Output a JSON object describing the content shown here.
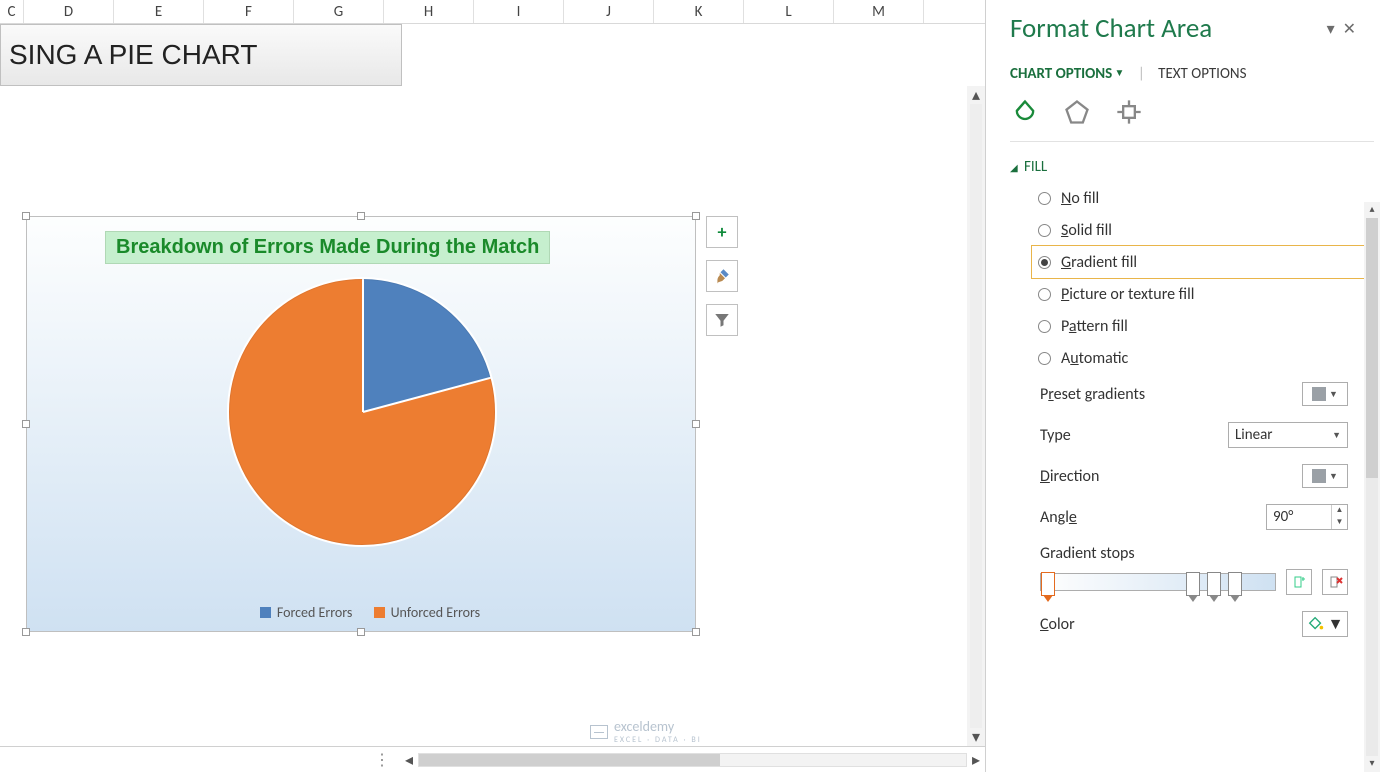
{
  "columns": [
    "C",
    "D",
    "E",
    "F",
    "G",
    "H",
    "I",
    "J",
    "K",
    "L",
    "M"
  ],
  "merged_cell_text": "SING A PIE CHART",
  "chart": {
    "title": "Breakdown of Errors Made During the Match",
    "legend": [
      "Forced Errors",
      "Unforced Errors"
    ]
  },
  "chart_data": {
    "type": "pie",
    "title": "Breakdown of Errors Made During the Match",
    "series": [
      {
        "name": "Forced Errors",
        "value": 21,
        "color": "#4f81bd"
      },
      {
        "name": "Unforced Errors",
        "value": 79,
        "color": "#ed7d31"
      }
    ]
  },
  "chart_buttons": {
    "plus": "+",
    "brush": "brush-icon",
    "filter": "filter-icon"
  },
  "watermark": {
    "text": "exceldemy",
    "sub": "EXCEL · DATA · BI"
  },
  "pane": {
    "title": "Format Chart Area",
    "tabs": {
      "chart_options": "CHART OPTIONS",
      "text_options": "TEXT OPTIONS"
    },
    "icons": {
      "fill": "paint-bucket-icon",
      "effects": "pentagon-icon",
      "size": "size-props-icon"
    },
    "section": "FILL",
    "fill_options": {
      "no_fill": "No fill",
      "solid_fill": "Solid fill",
      "gradient_fill": "Gradient fill",
      "picture_fill": "Picture or texture fill",
      "pattern_fill": "Pattern fill",
      "automatic": "Automatic",
      "selected": "gradient_fill"
    },
    "gradient": {
      "preset_label": "Preset gradients",
      "type_label": "Type",
      "type_value": "Linear",
      "direction_label": "Direction",
      "angle_label": "Angle",
      "angle_value": "90°",
      "stops_label": "Gradient stops",
      "color_label": "Color"
    }
  }
}
